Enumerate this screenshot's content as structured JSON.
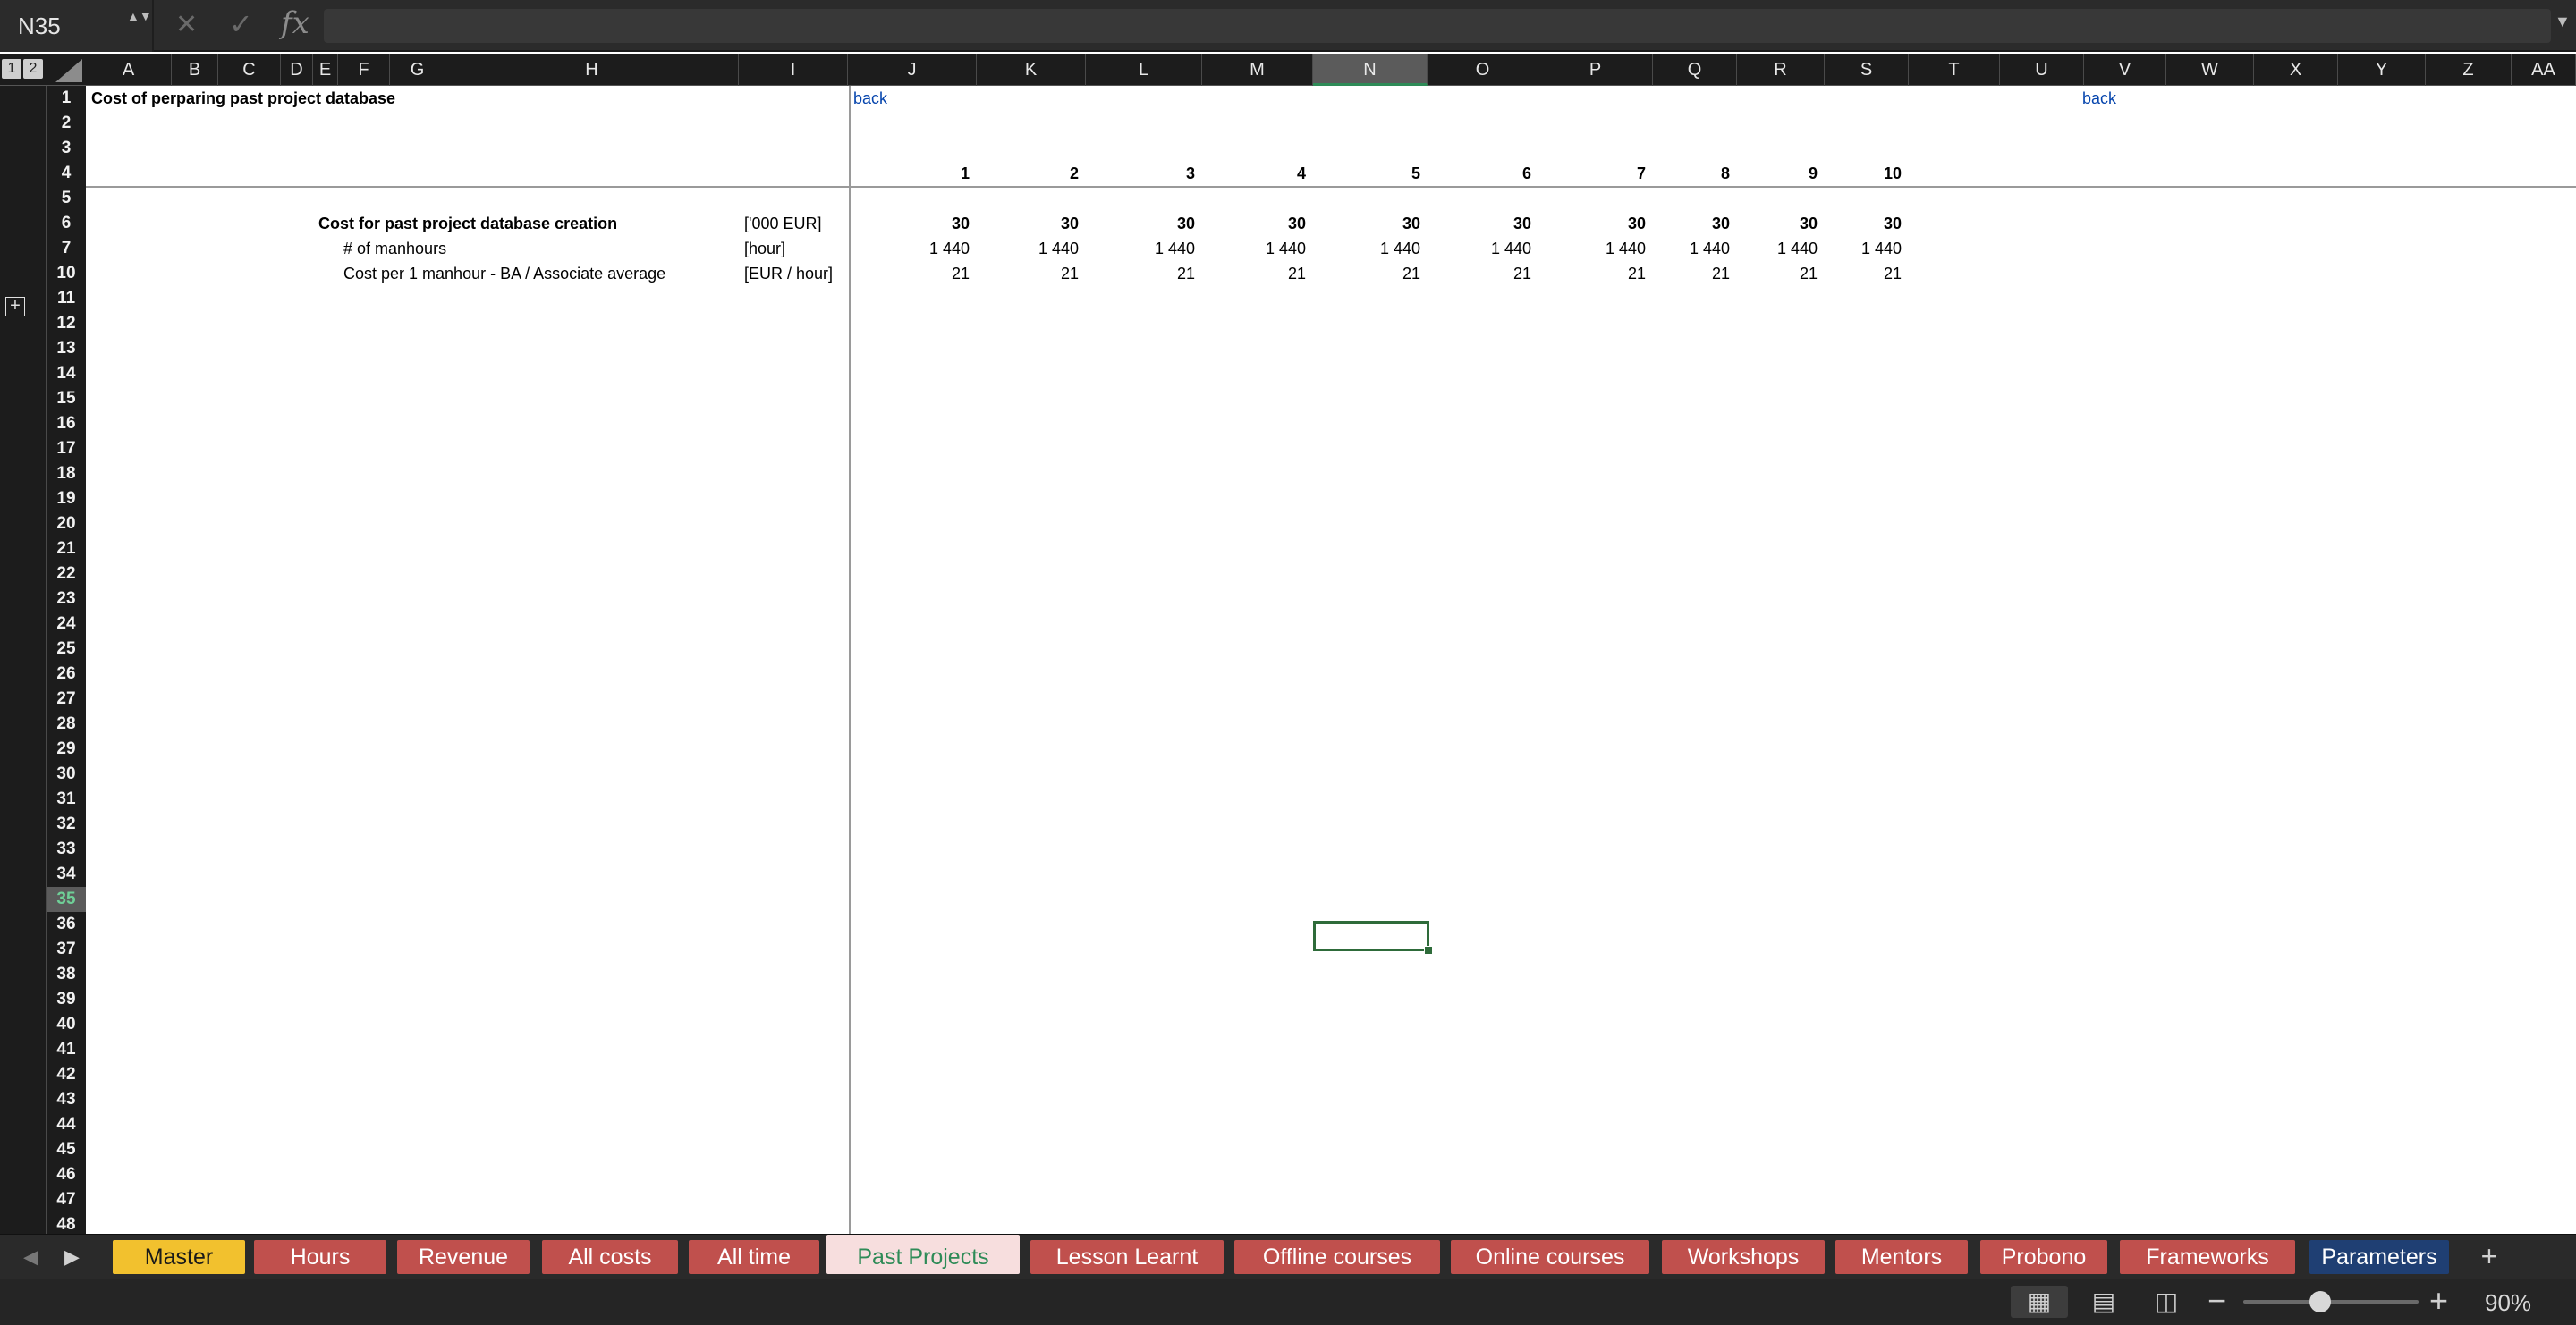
{
  "formula_bar": {
    "name_box": "N35",
    "stepper": "▲▼",
    "cancel_icon": "✕",
    "enter_icon": "✓",
    "fx": "fx",
    "expand_icon": "▼",
    "formula": ""
  },
  "outline_levels": [
    "1",
    "2"
  ],
  "outline_expand_icon": "+",
  "columns": [
    "A",
    "B",
    "C",
    "D",
    "E",
    "F",
    "G",
    "H",
    "I",
    "J",
    "K",
    "L",
    "M",
    "N",
    "O",
    "P",
    "Q",
    "R",
    "S",
    "T",
    "U",
    "V",
    "W",
    "X",
    "Y",
    "Z",
    "AA"
  ],
  "rows": [
    "1",
    "2",
    "3",
    "4",
    "5",
    "6",
    "7",
    "10",
    "11",
    "12",
    "13",
    "14",
    "15",
    "16",
    "17",
    "18",
    "19",
    "20",
    "21",
    "22",
    "23",
    "24",
    "25",
    "26",
    "27",
    "28",
    "29",
    "30",
    "31",
    "32",
    "33",
    "34",
    "35",
    "36",
    "37",
    "38",
    "39",
    "40",
    "41",
    "42",
    "43",
    "44",
    "45",
    "46",
    "47",
    "48"
  ],
  "active_column": "N",
  "active_row": "35",
  "sheet": {
    "title": "Cost of perparing past project database",
    "back_link_1": "back",
    "back_link_2": "back",
    "period_headers": [
      "1",
      "2",
      "3",
      "4",
      "5",
      "6",
      "7",
      "8",
      "9",
      "10"
    ],
    "table_rows": [
      {
        "label": "Cost for past project database creation",
        "unit": "['000 EUR]",
        "values": [
          "30",
          "30",
          "30",
          "30",
          "30",
          "30",
          "30",
          "30",
          "30",
          "30"
        ],
        "bold": true
      },
      {
        "label": "# of manhours",
        "unit": "[hour]",
        "values": [
          "1 440",
          "1 440",
          "1 440",
          "1 440",
          "1 440",
          "1 440",
          "1 440",
          "1 440",
          "1 440",
          "1 440"
        ],
        "bold": false
      },
      {
        "label": "Cost per 1 manhour - BA / Associate average",
        "unit": "[EUR / hour]",
        "values": [
          "21",
          "21",
          "21",
          "21",
          "21",
          "21",
          "21",
          "21",
          "21",
          "21"
        ],
        "bold": false
      }
    ]
  },
  "tabs": {
    "prev_icon": "◀",
    "next_icon": "▶",
    "add_icon": "+",
    "items": [
      {
        "label": "Master",
        "color": "#f2c12e",
        "text_color": "#1a1a1a",
        "active": false
      },
      {
        "label": "Hours",
        "color": "#c0504d",
        "text_color": "#ffffff",
        "active": false
      },
      {
        "label": "Revenue",
        "color": "#c0504d",
        "text_color": "#ffffff",
        "active": false
      },
      {
        "label": "All costs",
        "color": "#c0504d",
        "text_color": "#ffffff",
        "active": false
      },
      {
        "label": "All time",
        "color": "#c0504d",
        "text_color": "#ffffff",
        "active": false
      },
      {
        "label": "Past Projects",
        "color": "#f7dede",
        "text_color": "#2e8b57",
        "active": true
      },
      {
        "label": "Lesson Learnt",
        "color": "#c0504d",
        "text_color": "#ffffff",
        "active": false
      },
      {
        "label": "Offline courses",
        "color": "#c0504d",
        "text_color": "#ffffff",
        "active": false
      },
      {
        "label": "Online courses",
        "color": "#c0504d",
        "text_color": "#ffffff",
        "active": false
      },
      {
        "label": "Workshops",
        "color": "#c0504d",
        "text_color": "#ffffff",
        "active": false
      },
      {
        "label": "Mentors",
        "color": "#c0504d",
        "text_color": "#ffffff",
        "active": false
      },
      {
        "label": "Probono",
        "color": "#c0504d",
        "text_color": "#ffffff",
        "active": false
      },
      {
        "label": "Frameworks",
        "color": "#c0504d",
        "text_color": "#ffffff",
        "active": false
      },
      {
        "label": "Parameters",
        "color": "#1f3f73",
        "text_color": "#ffffff",
        "active": false
      }
    ]
  },
  "status_bar": {
    "view_normal_icon": "▦",
    "view_page_layout_icon": "▤",
    "view_page_break_icon": "◫",
    "zoom_minus": "−",
    "zoom_plus": "+",
    "zoom_level": "90%",
    "zoom_fraction": 0.38
  }
}
